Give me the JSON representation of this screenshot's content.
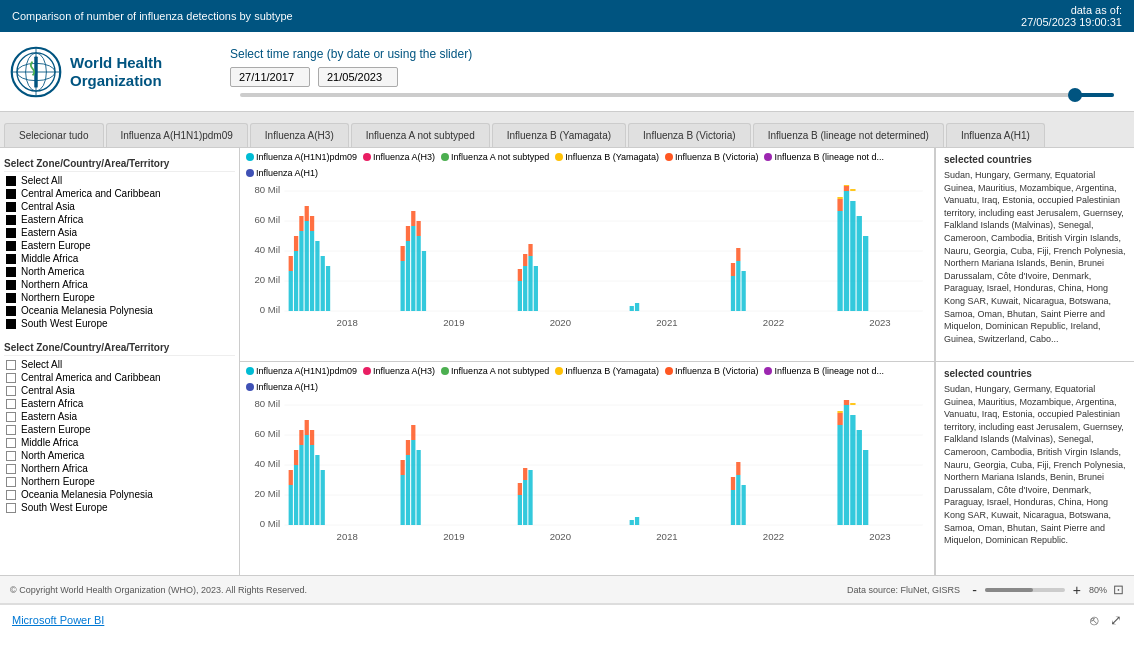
{
  "topBar": {
    "title": "Comparison of  number of influenza detections by subtype",
    "dataAs": "data as of:",
    "dataDate": "27/05/2023 19:00:31"
  },
  "header": {
    "whoName": "World Health Organization",
    "datePrompt": "Select time range (by date or using the slider)",
    "dateFrom": "27/11/2017",
    "dateTo": "21/05/2023"
  },
  "tabs": [
    {
      "label": "Selecionar tudo",
      "active": false
    },
    {
      "label": "Influenza A(H1N1)pdm09",
      "active": false
    },
    {
      "label": "Influenza A(H3)",
      "active": false
    },
    {
      "label": "Influenza A not subtyped",
      "active": false
    },
    {
      "label": "Influenza B (Yamagata)",
      "active": false
    },
    {
      "label": "Influenza B (Victoria)",
      "active": false
    },
    {
      "label": "Influenza B (lineage not determined)",
      "active": false
    },
    {
      "label": "Influenza A(H1)",
      "active": false
    }
  ],
  "zonePanel1": {
    "header": "Select Zone/Country/Area/Territory",
    "items": [
      {
        "label": "Select All",
        "checked": true
      },
      {
        "label": "Central America and Caribbean",
        "checked": true
      },
      {
        "label": "Central Asia",
        "checked": true
      },
      {
        "label": "Eastern Africa",
        "checked": true
      },
      {
        "label": "Eastern Asia",
        "checked": true
      },
      {
        "label": "Eastern Europe",
        "checked": true
      },
      {
        "label": "Middle Africa",
        "checked": true
      },
      {
        "label": "North America",
        "checked": true
      },
      {
        "label": "Northern Africa",
        "checked": true
      },
      {
        "label": "Northern Europe",
        "checked": true
      },
      {
        "label": "Oceania Melanesia Polynesia",
        "checked": true
      },
      {
        "label": "South West Europe",
        "checked": true
      }
    ]
  },
  "zonePanel2": {
    "header": "Select Zone/Country/Area/Territory",
    "items": [
      {
        "label": "Select All",
        "checked": false
      },
      {
        "label": "Central America and Caribbean",
        "checked": false
      },
      {
        "label": "Central Asia",
        "checked": false
      },
      {
        "label": "Eastern Africa",
        "checked": false
      },
      {
        "label": "Eastern Asia",
        "checked": false
      },
      {
        "label": "Eastern Europe",
        "checked": false
      },
      {
        "label": "Middle Africa",
        "checked": false
      },
      {
        "label": "North America",
        "checked": false
      },
      {
        "label": "Northern Africa",
        "checked": false
      },
      {
        "label": "Northern Europe",
        "checked": false
      },
      {
        "label": "Oceania Melanesia Polynesia",
        "checked": false
      },
      {
        "label": "South West Europe",
        "checked": false
      }
    ]
  },
  "legend": {
    "items": [
      {
        "label": "Influenza A(H1N1)pdm09",
        "color": "#00BCD4"
      },
      {
        "label": "Influenza A(H3)",
        "color": "#E91E63"
      },
      {
        "label": "Influenza A not subtyped",
        "color": "#4CAF50"
      },
      {
        "label": "Influenza B (Yamagata)",
        "color": "#FFC107"
      },
      {
        "label": "Influenza B (Victoria)",
        "color": "#FF5722"
      },
      {
        "label": "Influenza B (lineage not d...",
        "color": "#9C27B0"
      },
      {
        "label": "Influenza A(H1)",
        "color": "#3F51B5"
      }
    ]
  },
  "selectedCountries1": {
    "title": "selected countries",
    "text": "Sudan, Hungary, Germany, Equatorial Guinea, Mauritius, Mozambique, Argentina, Vanuatu, Iraq, Estonia, occupied Palestinian territory, including east Jerusalem, Guernsey, Falkland Islands (Malvinas), Senegal, Cameroon, Cambodia, British Virgin Islands, Nauru, Georgia, Cuba, Fiji, French Polynesia, Northern Mariana Islands, Benin, Brunei Darussalam, Côte d'Ivoire, Denmark, Paraguay, Israel, Honduras, China, Hong Kong SAR, Kuwait, Nicaragua, Botswana, Samoa, Oman, Bhutan, Saint Pierre and Miquelon, Dominican Republic, Ireland, Guinea, Switzerland, Cabo..."
  },
  "selectedCountries2": {
    "title": "selected countries",
    "text": "Sudan, Hungary, Germany, Equatorial Guinea, Mauritius, Mozambique, Argentina, Vanuatu, Iraq, Estonia, occupied Palestinian territory, including east Jerusalem, Guernsey, Falkland Islands (Malvinas), Senegal, Cameroon, Cambodia, British Virgin Islands, Nauru, Georgia, Cuba, Fiji, French Polynesia, Northern Mariana Islands, Benin, Brunei Darussalam, Côte d'Ivoire, Denmark, Paraguay, Israel, Honduras, China, Hong Kong SAR, Kuwait, Nicaragua, Botswana, Samoa, Oman, Bhutan, Saint Pierre and Miquelon, Dominican Republic."
  },
  "bottomBar": {
    "copyright": "© Copyright World Health Organization (WHO), 2023. All Rights Reserved.",
    "dataSource": "Data source: FluNet, GISRS",
    "zoomLevel": "80%",
    "zoomMinus": "-",
    "zoomPlus": "+"
  },
  "footer": {
    "powerbLabel": "Microsoft Power BI"
  },
  "chartYLabels": [
    "80 Mil",
    "60 Mil",
    "40 Mil",
    "20 Mil",
    "0 Mil"
  ],
  "chartXLabels": [
    "2018",
    "2019",
    "2020",
    "2021",
    "2022",
    "2023"
  ]
}
